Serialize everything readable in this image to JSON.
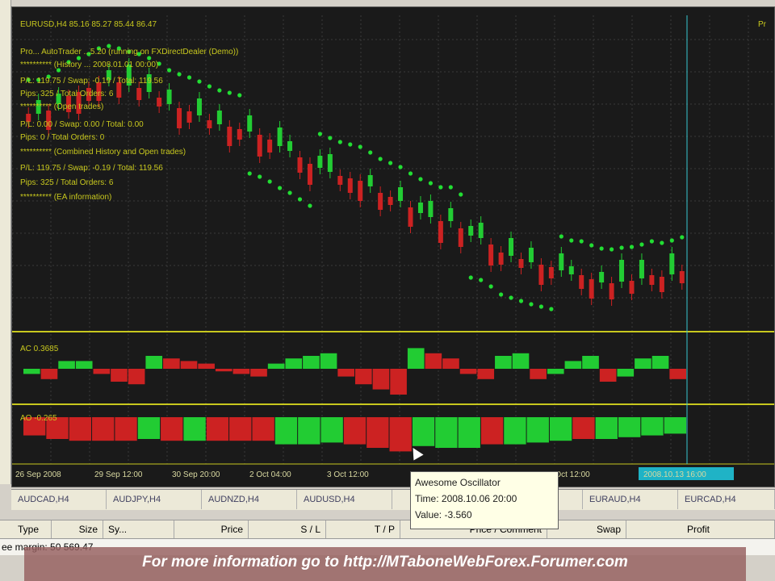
{
  "chart": {
    "symbol_line": "EURUSD,H4  85.16 85.27 85.44 86.47",
    "right_label": "Pr",
    "ea_info": [
      "Pro...  AutoTrader ...5.20  (running on FXDirectDealer (Demo))",
      "**********  (History ...  2008.01.01 00:00)",
      "P/L: 119.75 / Swap: -0.19 / Total: 119.56",
      "Pips: 325 / Total Orders: 6",
      "**********  (Open trades)",
      "P/L: 0.00 / Swap: 0.00 / Total: 0.00",
      "Pips: 0 / Total Orders: 0",
      "**********  (Combined History and Open trades)",
      "P/L: 119.75 / Swap: -0.19 / Total: 119.56",
      "Pips: 325 / Total Orders: 6",
      "**********  (EA information)"
    ],
    "ac_label": "AC 0.3685",
    "ao_label": "AO -0.265",
    "time_labels": [
      "26 Sep 2008",
      "29 Sep 12:00",
      "30 Sep 20:00",
      "2 Oct 04:00",
      "3 Oct 12:00",
      "6 Oct 12:00"
    ],
    "highlight_time": "2008.10.13 16:00"
  },
  "chart_data": {
    "type": "candlestick",
    "candle_closes": [
      72,
      72,
      68,
      60,
      50,
      45,
      40,
      33,
      30,
      33,
      37,
      40,
      45,
      52,
      60,
      65,
      69,
      74,
      80,
      85,
      88,
      91,
      94,
      98,
      104,
      112,
      118,
      126,
      134,
      139,
      144,
      149,
      152,
      155,
      162,
      170,
      175,
      180,
      188,
      195,
      200,
      205,
      205,
      214,
      223,
      226,
      234,
      244,
      248,
      252,
      256,
      259,
      262,
      266,
      271,
      272,
      277,
      281,
      282,
      280,
      279,
      276,
      272,
      274,
      271,
      267
    ],
    "candle_bull": [
      0,
      1,
      0,
      1,
      0,
      0,
      0,
      0,
      1,
      0,
      1,
      0,
      1,
      0,
      1,
      0,
      0,
      1,
      0,
      1,
      0,
      0,
      1,
      0,
      0,
      1,
      1,
      0,
      0,
      1,
      1,
      0,
      0,
      0,
      1,
      0,
      0,
      1,
      0,
      1,
      1,
      0,
      1,
      0,
      1,
      1,
      0,
      0,
      1,
      0,
      1,
      0,
      0,
      1,
      1,
      0,
      0,
      1,
      0,
      1,
      0,
      1,
      0,
      0,
      1,
      0
    ],
    "ac_values": [
      -0.2,
      -0.4,
      0.3,
      0.3,
      -0.2,
      -0.5,
      -0.6,
      0.5,
      0.4,
      0.3,
      0.2,
      -0.1,
      -0.2,
      -0.3,
      0.2,
      0.4,
      0.5,
      0.6,
      -0.3,
      -0.6,
      -0.8,
      -1.0,
      0.8,
      0.6,
      0.4,
      -0.2,
      -0.4,
      0.5,
      0.6,
      -0.4,
      -0.2,
      0.3,
      0.5,
      -0.5,
      -0.3,
      0.4,
      0.5,
      -0.4
    ],
    "ao_values": [
      -0.3,
      -0.5,
      -0.6,
      -0.6,
      -0.6,
      0.5,
      -0.6,
      0.6,
      -0.6,
      -0.6,
      -0.6,
      0.8,
      0.8,
      0.7,
      -0.8,
      -1.0,
      -1.2,
      0.9,
      1.0,
      1.0,
      -0.8,
      0.8,
      0.7,
      0.6,
      -0.5,
      0.5,
      0.4,
      0.3,
      0.2
    ]
  },
  "tabs": [
    "AUDCAD,H4",
    "AUDJPY,H4",
    "AUDNZD,H4",
    "AUDUSD,H4",
    "",
    "...,H4",
    "EURAUD,H4",
    "EURCAD,H4"
  ],
  "terminal": {
    "columns": [
      "Type",
      "Size",
      "Sy...",
      "Price",
      "S / L",
      "T / P",
      "Price  /  Comment",
      "Swap",
      "Profit"
    ],
    "status_text": "ee margin: 50 569.47"
  },
  "tooltip": {
    "title": "Awesome Oscillator",
    "time": "Time: 2008.10.06 20:00",
    "value": "Value: -3.560"
  },
  "banner": {
    "text": "For more information go to http://MTaboneWebForex.Forumer.com"
  },
  "colors": {
    "bull": "#22cc33",
    "bear": "#cc2222",
    "grid": "#3a3a3a",
    "separator": "#c8c81e",
    "sar_dots": "#22dd33",
    "highlight_line": "#35c8d0"
  }
}
